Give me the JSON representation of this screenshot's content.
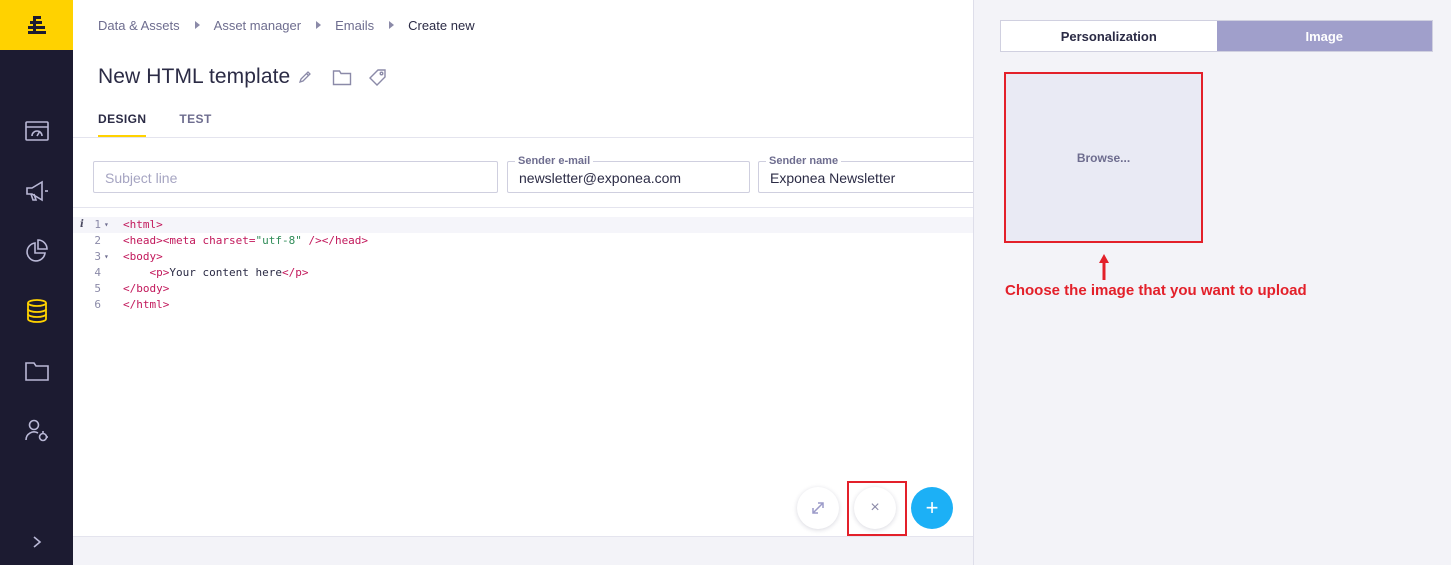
{
  "colors": {
    "rail_bg": "#1c1b31",
    "brand_yellow": "#ffd200",
    "accent_blue": "#1cb0f6",
    "active_tab_purple": "#a09fcb",
    "annotation_red": "#e3202a"
  },
  "rail": {
    "logo_icon": "brand-logo-icon",
    "items": [
      {
        "icon": "dashboard-icon"
      },
      {
        "icon": "megaphone-icon"
      },
      {
        "icon": "pie-chart-icon"
      },
      {
        "icon": "database-icon",
        "active": true
      },
      {
        "icon": "folder-icon"
      },
      {
        "icon": "user-settings-icon"
      }
    ],
    "expand_icon": "chevron-right-icon"
  },
  "breadcrumb": {
    "items": [
      "Data & Assets",
      "Asset manager",
      "Emails"
    ],
    "current": "Create new"
  },
  "header": {
    "title": "New HTML template",
    "icons": [
      "pencil-icon",
      "folder-icon",
      "tag-icon"
    ]
  },
  "tabs": {
    "items": [
      {
        "label": "DESIGN",
        "active": true
      },
      {
        "label": "TEST",
        "active": false
      }
    ]
  },
  "form": {
    "subject": {
      "placeholder": "Subject line",
      "value": ""
    },
    "sender_email": {
      "label": "Sender e-mail",
      "value": "newsletter@exponea.com"
    },
    "sender_name": {
      "label": "Sender name",
      "value": "Exponea Newsletter"
    }
  },
  "code": {
    "info_marker": "i",
    "lines": [
      {
        "num": "1",
        "fold": true,
        "tokens": [
          {
            "c": "tg",
            "t": "<html>"
          }
        ]
      },
      {
        "num": "2",
        "fold": false,
        "tokens": [
          {
            "c": "tg",
            "t": "<head><meta "
          },
          {
            "c": "at",
            "t": "charset="
          },
          {
            "c": "st",
            "t": "\"utf-8\""
          },
          {
            "c": "tg",
            "t": " /></head>"
          }
        ]
      },
      {
        "num": "3",
        "fold": true,
        "tokens": [
          {
            "c": "tg",
            "t": "<body>"
          }
        ]
      },
      {
        "num": "4",
        "fold": false,
        "tokens": [
          {
            "c": "tx",
            "t": "    "
          },
          {
            "c": "tg",
            "t": "<p>"
          },
          {
            "c": "tx",
            "t": "Your content here"
          },
          {
            "c": "tg",
            "t": "</p>"
          }
        ]
      },
      {
        "num": "5",
        "fold": false,
        "tokens": [
          {
            "c": "tg",
            "t": "</body>"
          }
        ]
      },
      {
        "num": "6",
        "fold": false,
        "tokens": [
          {
            "c": "tg",
            "t": "</html>"
          }
        ]
      }
    ]
  },
  "fabs": {
    "expand_icon": "expand-icon",
    "close_icon": "close-icon",
    "close_symbol": "×",
    "add_symbol": "+"
  },
  "panel": {
    "tabs": [
      {
        "label": "Personalization",
        "active": false
      },
      {
        "label": "Image",
        "active": true
      }
    ],
    "browse_label": "Browse...",
    "annotation": "Choose the image that you want to upload"
  }
}
